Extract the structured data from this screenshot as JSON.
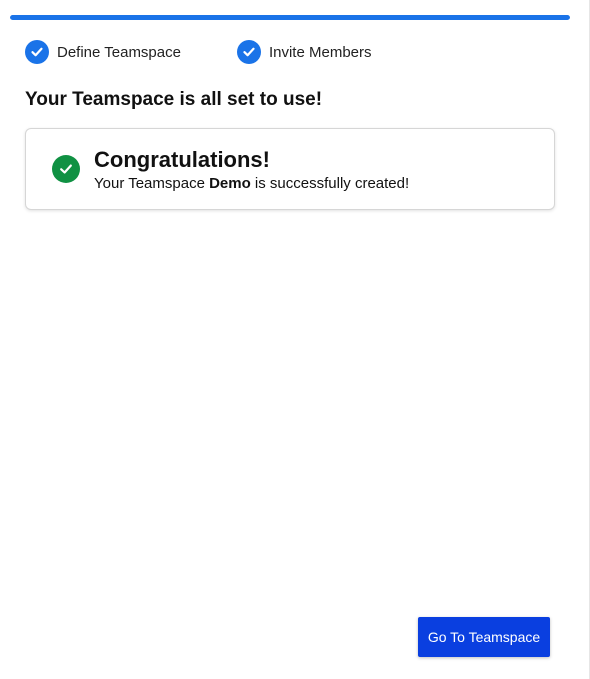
{
  "progress": {
    "fraction": 1.0,
    "color": "#1a73e8"
  },
  "steps": [
    {
      "label": "Define Teamspace",
      "status": "completed",
      "icon": "check-circle-icon"
    },
    {
      "label": "Invite Members",
      "status": "completed",
      "icon": "check-circle-icon"
    }
  ],
  "heading": "Your Teamspace is all set to use!",
  "success_card": {
    "icon": "check-circle-icon",
    "icon_color": "#109143",
    "title": "Congratulations!",
    "message_prefix": "Your Teamspace ",
    "teamspace_name": "Demo",
    "message_suffix": " is successfully created!"
  },
  "actions": {
    "go_to_teamspace_label": "Go To Teamspace",
    "button_color": "#0a3fe0"
  }
}
